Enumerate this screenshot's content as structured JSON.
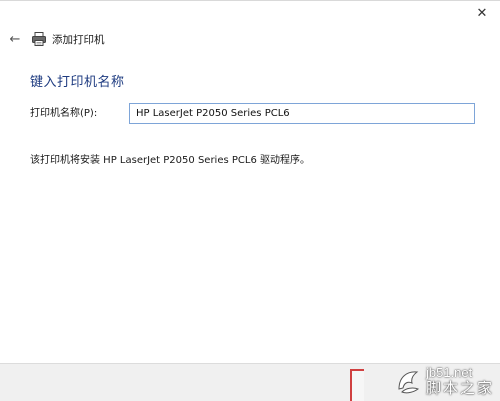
{
  "window": {
    "close_glyph": "✕"
  },
  "nav": {
    "back_glyph": "←",
    "title": "添加打印机"
  },
  "main": {
    "heading": "键入打印机名称",
    "name_label": "打印机名称(P):",
    "name_value": "HP LaserJet P2050 Series PCL6",
    "info_text": "该打印机将安装 HP LaserJet P2050 Series PCL6 驱动程序。"
  },
  "watermark": {
    "url": "jb51.net",
    "name": "脚本之家"
  },
  "icons": {
    "back": "back-arrow-icon",
    "printer": "printer-icon",
    "close": "close-icon",
    "watermark_logo": "watermark-logo-icon"
  },
  "colors": {
    "heading": "#1e3b80",
    "input_border": "#7ea5d8",
    "footer_bg": "#f0f0f0",
    "highlight": "#d04040"
  }
}
